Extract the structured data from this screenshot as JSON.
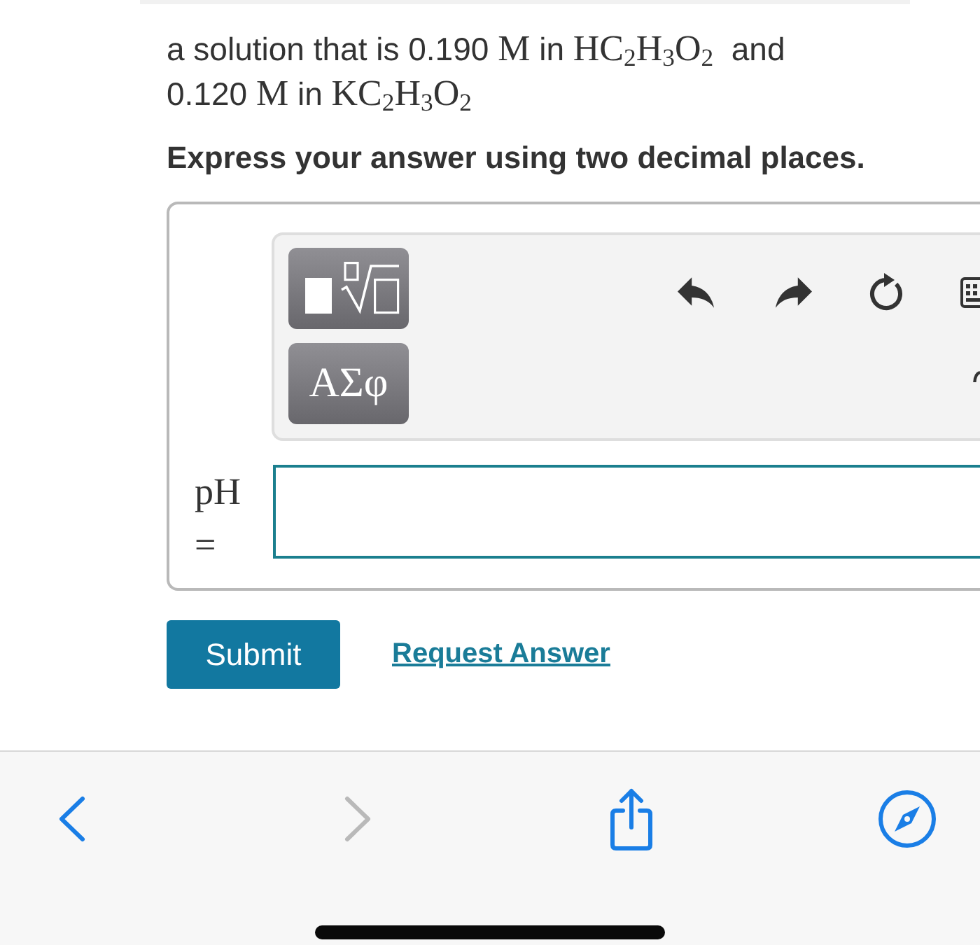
{
  "question": {
    "segments": [
      {
        "kind": "text",
        "text": "a solution that is 0.190 "
      },
      {
        "kind": "math",
        "text": "M"
      },
      {
        "kind": "text",
        "text": " in "
      },
      {
        "kind": "math",
        "text": "HC$_{2}$H$_{3}$O$_{2}$"
      },
      {
        "kind": "text",
        "text": "  and 0.120 "
      },
      {
        "kind": "math",
        "text": "M"
      },
      {
        "kind": "text",
        "text": " in "
      },
      {
        "kind": "math",
        "text": "KC$_{2}$H$_{3}$O$_{2}$"
      }
    ]
  },
  "instruction": "Express your answer using two decimal places.",
  "answer": {
    "symbols_button": "ΑΣφ",
    "label": "pH ="
  },
  "actions": {
    "submit": "Submit",
    "request_answer": "Request Answer"
  },
  "browser_toolbar": {
    "back": {
      "disabled": false
    },
    "forward": {
      "disabled": true
    }
  }
}
